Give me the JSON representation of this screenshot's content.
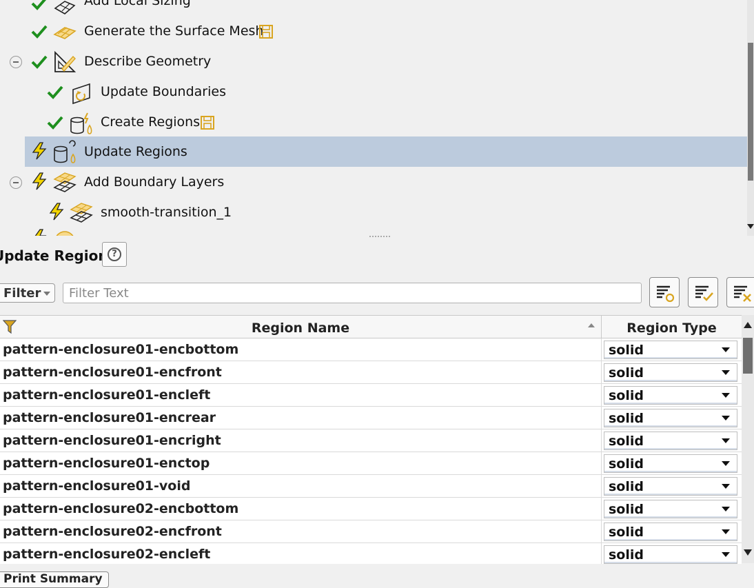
{
  "tree": {
    "items": [
      {
        "label": "Add Local Sizing",
        "status": "check",
        "icon": "local-sizing-icon"
      },
      {
        "label": "Generate the Surface Mesh",
        "status": "check",
        "icon": "surface-mesh-icon",
        "saved": true
      },
      {
        "label": "Describe Geometry",
        "status": "check",
        "icon": "describe-geometry-icon",
        "collapsible": true
      },
      {
        "label": "Update Boundaries",
        "status": "check",
        "icon": "update-boundaries-icon"
      },
      {
        "label": "Create Regions",
        "status": "check",
        "icon": "create-regions-icon",
        "saved": true
      },
      {
        "label": "Update Regions",
        "status": "pending",
        "icon": "update-regions-icon",
        "selected": true
      },
      {
        "label": "Add Boundary Layers",
        "status": "pending",
        "icon": "boundary-layers-icon",
        "collapsible": true
      },
      {
        "label": "smooth-transition_1",
        "status": "pending",
        "icon": "boundary-layers-icon"
      }
    ]
  },
  "panel": {
    "title": "Update Regions",
    "help_label": "?",
    "filter_label": "Filter",
    "filter_placeholder": "Filter Text"
  },
  "table": {
    "columns": [
      "Region Name",
      "Region Type"
    ],
    "rows": [
      {
        "name": "pattern-enclosure01-encbottom",
        "type": "solid"
      },
      {
        "name": "pattern-enclosure01-encfront",
        "type": "solid"
      },
      {
        "name": "pattern-enclosure01-encleft",
        "type": "solid"
      },
      {
        "name": "pattern-enclosure01-encrear",
        "type": "solid"
      },
      {
        "name": "pattern-enclosure01-encright",
        "type": "solid"
      },
      {
        "name": "pattern-enclosure01-enctop",
        "type": "solid"
      },
      {
        "name": "pattern-enclosure01-void",
        "type": "solid"
      },
      {
        "name": "pattern-enclosure02-encbottom",
        "type": "solid"
      },
      {
        "name": "pattern-enclosure02-encfront",
        "type": "solid"
      },
      {
        "name": "pattern-enclosure02-encleft",
        "type": "solid"
      }
    ]
  },
  "footer": {
    "print_label": "Print Summary"
  },
  "colors": {
    "check": "#1e8f1e",
    "lightning": "#f2d300",
    "selected_row": "#bccbdd",
    "icon_gold": "#d9a520"
  }
}
